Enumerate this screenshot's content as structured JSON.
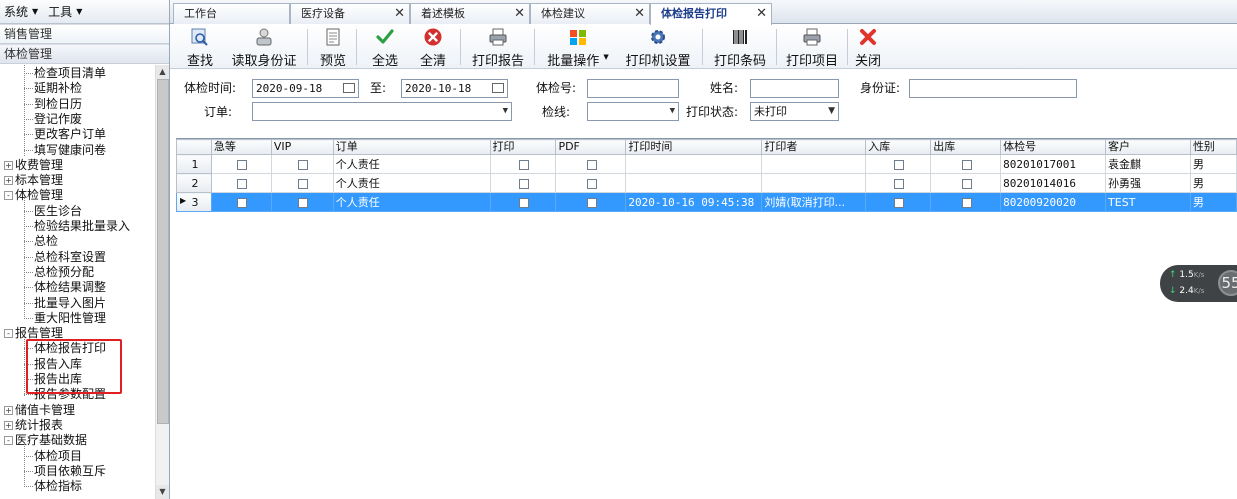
{
  "menubar": {
    "system": "系统",
    "tools": "工具"
  },
  "accordion": {
    "sales": "销售管理",
    "exam": "体检管理"
  },
  "tree": {
    "items": [
      {
        "label": "检查项目清单",
        "type": "child"
      },
      {
        "label": "延期补检",
        "type": "child"
      },
      {
        "label": "到检日历",
        "type": "child"
      },
      {
        "label": "登记作废",
        "type": "child"
      },
      {
        "label": "更改客户订单",
        "type": "child"
      },
      {
        "label": "填写健康问卷",
        "type": "child"
      },
      {
        "label": "收费管理",
        "type": "group",
        "exp": "+"
      },
      {
        "label": "标本管理",
        "type": "group",
        "exp": "+"
      },
      {
        "label": "体检管理",
        "type": "group",
        "exp": "−"
      },
      {
        "label": "医生诊台",
        "type": "child"
      },
      {
        "label": "检验结果批量录入",
        "type": "child"
      },
      {
        "label": "总检",
        "type": "child"
      },
      {
        "label": "总检科室设置",
        "type": "child"
      },
      {
        "label": "总检预分配",
        "type": "child"
      },
      {
        "label": "体检结果调整",
        "type": "child"
      },
      {
        "label": "批量导入图片",
        "type": "child"
      },
      {
        "label": "重大阳性管理",
        "type": "child"
      },
      {
        "label": "报告管理",
        "type": "group",
        "exp": "−"
      },
      {
        "label": "体检报告打印",
        "type": "child"
      },
      {
        "label": "报告入库",
        "type": "child"
      },
      {
        "label": "报告出库",
        "type": "child"
      },
      {
        "label": "报告参数配置",
        "type": "child"
      },
      {
        "label": "储值卡管理",
        "type": "group",
        "exp": "+"
      },
      {
        "label": "统计报表",
        "type": "group",
        "exp": "+"
      },
      {
        "label": "医疗基础数据",
        "type": "group",
        "exp": "−"
      },
      {
        "label": "体检项目",
        "type": "child"
      },
      {
        "label": "项目依赖互斥",
        "type": "child"
      },
      {
        "label": "体检指标",
        "type": "child"
      }
    ]
  },
  "tabs": [
    {
      "label": "工作台",
      "closable": false,
      "active": false
    },
    {
      "label": "医疗设备",
      "closable": true,
      "active": false
    },
    {
      "label": "着述模板",
      "closable": true,
      "active": false
    },
    {
      "label": "体检建议",
      "closable": true,
      "active": false
    },
    {
      "label": "体检报告打印",
      "closable": true,
      "active": true
    }
  ],
  "toolbar": {
    "search": "查找",
    "read_id": "读取身份证",
    "preview": "预览",
    "select_all": "全选",
    "clear_all": "全清",
    "print_report": "打印报告",
    "batch_ops": "批量操作",
    "printer_setup": "打印机设置",
    "print_barcode": "打印条码",
    "print_items": "打印项目",
    "close": "关闭"
  },
  "filters": {
    "exam_time_label": "体检时间:",
    "date_from": "2020-09-18",
    "to_label": "至:",
    "date_to": "2020-10-18",
    "exam_no_label": "体检号:",
    "exam_no_value": "",
    "name_label": "姓名:",
    "name_value": "",
    "id_card_label": "身份证:",
    "id_card_value": "",
    "order_label": "订单:",
    "order_value": "",
    "line_label": "检线:",
    "line_value": "",
    "print_status_label": "打印状态:",
    "print_status_value": "未打印"
  },
  "grid": {
    "columns": [
      "急等",
      "VIP",
      "订单",
      "打印",
      "PDF",
      "打印时间",
      "打印者",
      "入库",
      "出库",
      "体检号",
      "客户",
      "性别"
    ],
    "rows": [
      {
        "n": "1",
        "order": "个人责任",
        "print_time": "",
        "printer": "",
        "exam_no": "80201017001",
        "customer": "袁金麒",
        "gender": "男",
        "selected": false
      },
      {
        "n": "2",
        "order": "个人责任",
        "print_time": "",
        "printer": "",
        "exam_no": "80201014016",
        "customer": "孙勇强",
        "gender": "男",
        "selected": false
      },
      {
        "n": "3",
        "order": "个人责任",
        "print_time": "2020-10-16 09:45:38",
        "printer": "刘婧(取消打印...",
        "exam_no": "80200920020",
        "customer": "TEST",
        "gender": "男",
        "selected": true
      }
    ]
  },
  "net_widget": {
    "upload": "1.5",
    "upload_unit": "K/s",
    "download": "2.4",
    "download_unit": "K/s",
    "percent": "55"
  },
  "colors": {
    "selection": "#3399ff",
    "highlight_box": "#e02020",
    "active_tab_text": "#1c3d8c"
  }
}
